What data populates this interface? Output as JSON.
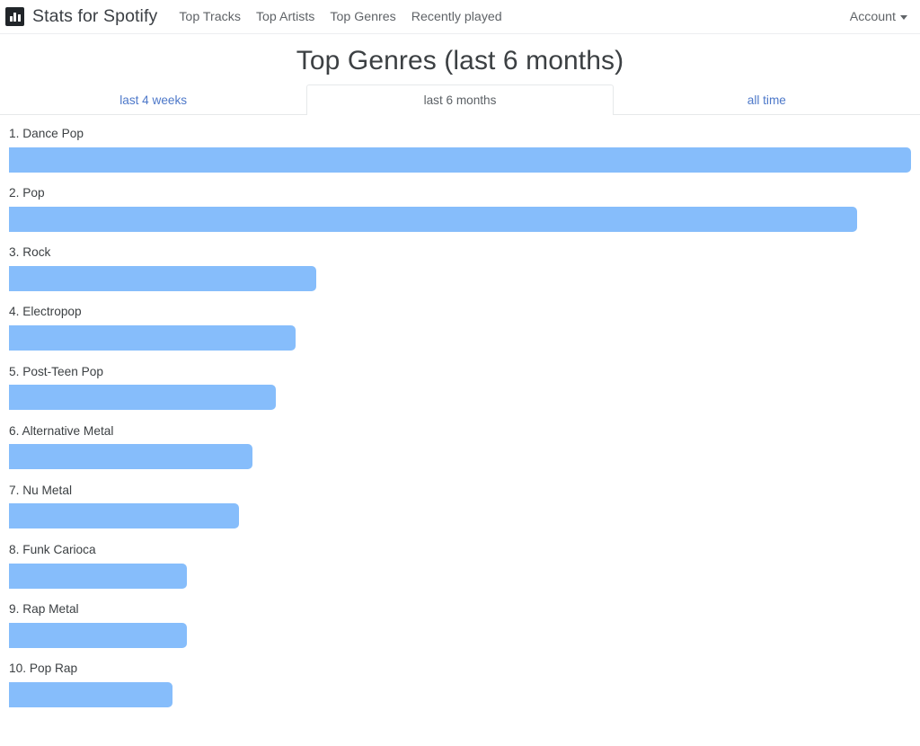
{
  "navbar": {
    "brand": "Stats for Spotify",
    "brand_icon": "bar-chart-icon",
    "links": [
      {
        "label": "Top Tracks"
      },
      {
        "label": "Top Artists"
      },
      {
        "label": "Top Genres"
      },
      {
        "label": "Recently played"
      }
    ],
    "account": {
      "label": "Account",
      "icon": "chevron-down-icon"
    }
  },
  "main": {
    "title": "Top Genres (last 6 months)",
    "tabs": [
      {
        "label": "last 4 weeks",
        "active": false
      },
      {
        "label": "last 6 months",
        "active": true
      },
      {
        "label": "all time",
        "active": false
      }
    ]
  },
  "colors": {
    "bar": "#86bdfb",
    "link": "#4d78c9",
    "text": "#3c4043",
    "muted": "#5f6367"
  },
  "chart_data": {
    "type": "bar",
    "title": "Top Genres (last 6 months)",
    "orientation": "horizontal",
    "xlabel": "",
    "ylabel": "",
    "value_unit": "relative share (%)",
    "xlim": [
      0,
      100
    ],
    "grid": false,
    "legend": null,
    "categories": [
      "Dance Pop",
      "Pop",
      "Rock",
      "Electropop",
      "Post-Teen Pop",
      "Alternative Metal",
      "Nu Metal",
      "Funk Carioca",
      "Rap Metal",
      "Pop Rap"
    ],
    "values": [
      100,
      94,
      34.1,
      31.8,
      29.6,
      27,
      25.5,
      19.7,
      19.7,
      18.1
    ],
    "items": [
      {
        "rank": 1,
        "label": "1. Dance Pop",
        "name": "Dance Pop",
        "value": 100
      },
      {
        "rank": 2,
        "label": "2. Pop",
        "name": "Pop",
        "value": 94
      },
      {
        "rank": 3,
        "label": "3. Rock",
        "name": "Rock",
        "value": 34.1
      },
      {
        "rank": 4,
        "label": "4. Electropop",
        "name": "Electropop",
        "value": 31.8
      },
      {
        "rank": 5,
        "label": "5. Post-Teen Pop",
        "name": "Post-Teen Pop",
        "value": 29.6
      },
      {
        "rank": 6,
        "label": "6. Alternative Metal",
        "name": "Alternative Metal",
        "value": 27
      },
      {
        "rank": 7,
        "label": "7. Nu Metal",
        "name": "Nu Metal",
        "value": 25.5
      },
      {
        "rank": 8,
        "label": "8. Funk Carioca",
        "name": "Funk Carioca",
        "value": 19.7
      },
      {
        "rank": 9,
        "label": "9. Rap Metal",
        "name": "Rap Metal",
        "value": 19.7
      },
      {
        "rank": 10,
        "label": "10. Pop Rap",
        "name": "Pop Rap",
        "value": 18.1
      }
    ]
  }
}
